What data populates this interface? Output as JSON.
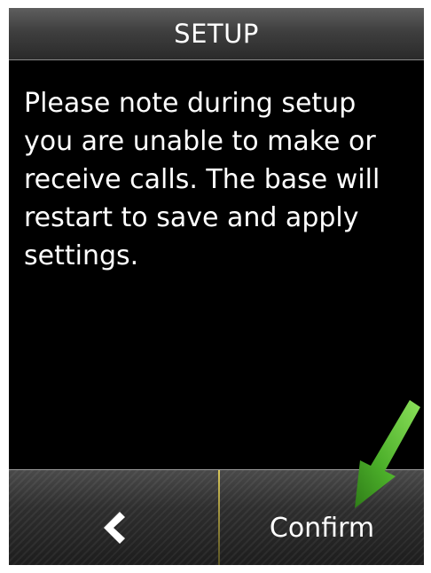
{
  "header": {
    "title": "SETUP"
  },
  "message": {
    "text": "Please note during setup\nyou are unable to make or\nreceive calls. The base will\nrestart to save and apply\nsettings."
  },
  "softkeys": {
    "left_icon": "back-chevron-icon",
    "right_label": "Confirm"
  },
  "annotation": {
    "pointer_icon": "green-arrow-icon",
    "pointer_color": "#4caf2a"
  },
  "colors": {
    "screen_background": "#000000",
    "text": "#ffffff",
    "divider_accent": "#d8c65a"
  }
}
